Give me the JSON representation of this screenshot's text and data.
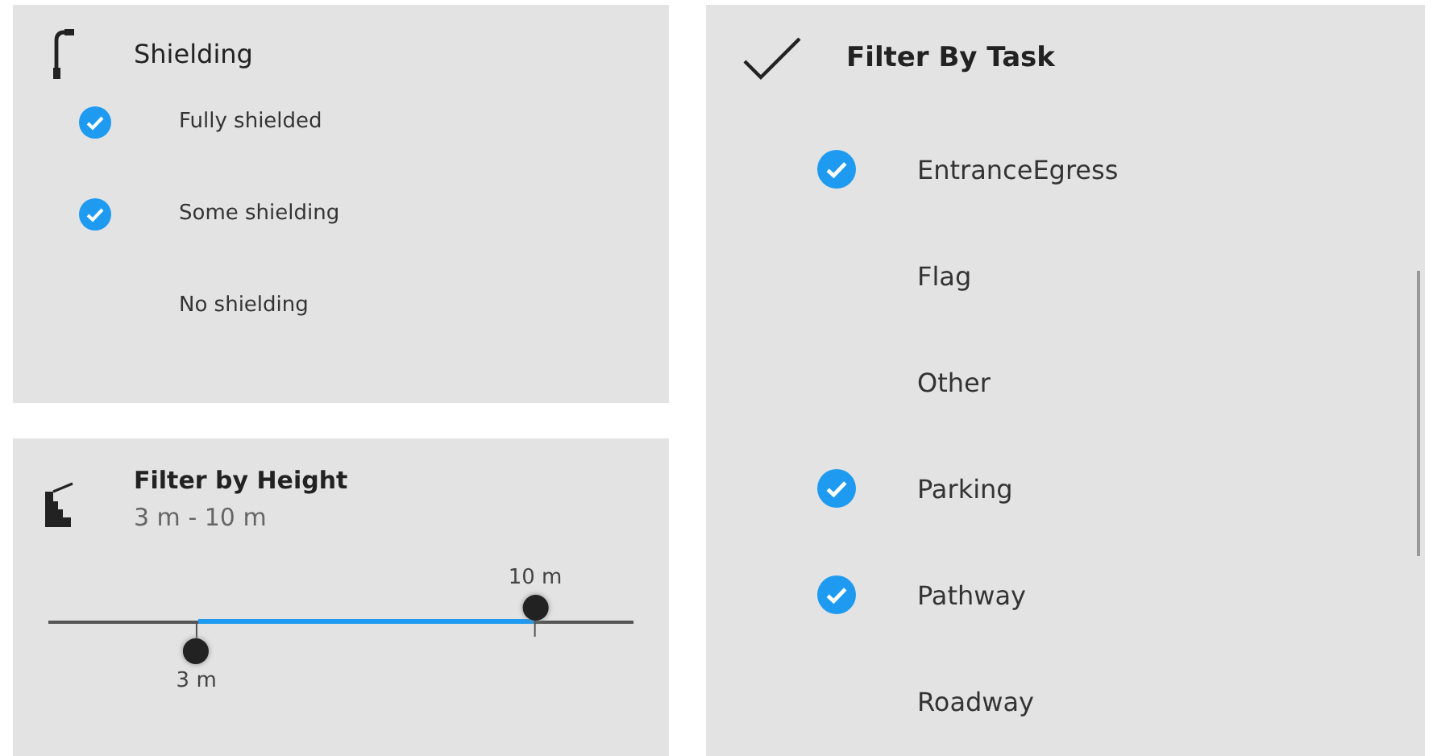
{
  "shielding": {
    "title": "Shielding",
    "options": [
      {
        "label": "Fully shielded",
        "checked": true
      },
      {
        "label": "Some shielding",
        "checked": true
      },
      {
        "label": "No shielding",
        "checked": false
      }
    ]
  },
  "height_filter": {
    "title": "Filter by Height",
    "range": "3 m - 10 m",
    "thumbs": [
      {
        "label": "3 m",
        "level": 0.253,
        "kind": "lower"
      },
      {
        "label": "10 m",
        "level": 0.832,
        "kind": "upper"
      }
    ]
  },
  "task_filter": {
    "title": "Filter By Task",
    "options": [
      {
        "label": "EntranceEgress",
        "checked": true
      },
      {
        "label": "Flag",
        "checked": false
      },
      {
        "label": "Other",
        "checked": false
      },
      {
        "label": "Parking",
        "checked": true
      },
      {
        "label": "Pathway",
        "checked": true
      },
      {
        "label": "Roadway",
        "checked": false
      }
    ]
  }
}
